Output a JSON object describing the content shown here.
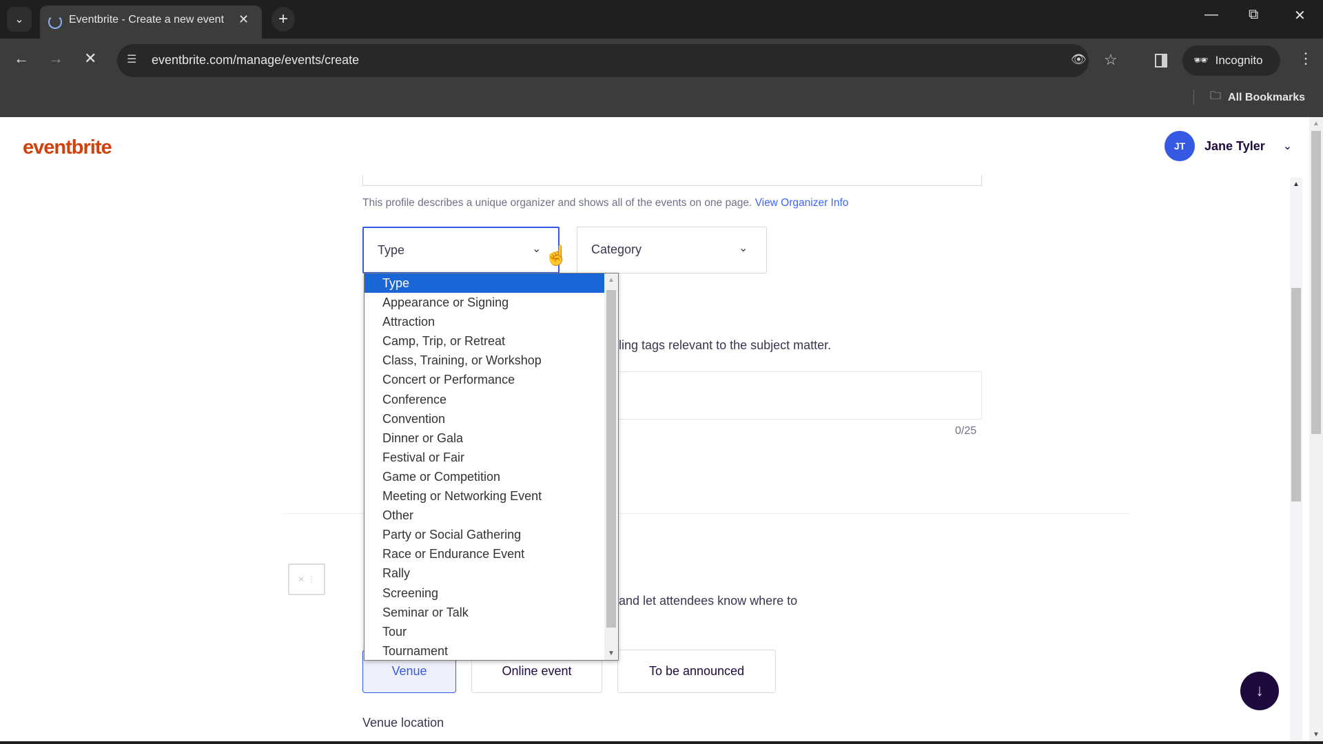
{
  "browser": {
    "tab_title": "Eventbrite - Create a new event",
    "url": "eventbrite.com/manage/events/create",
    "incognito_label": "Incognito",
    "bookmarks_label": "All Bookmarks",
    "icons": {
      "tab_list": "chevron-down-icon",
      "new_tab": "plus-icon",
      "back": "arrow-left-icon",
      "forward": "arrow-right-icon",
      "stop": "close-icon",
      "site_info": "tune-icon",
      "tracking": "eye-off-icon",
      "bookmark": "star-icon",
      "side_panel": "side-panel-icon",
      "menu": "kebab-icon"
    }
  },
  "header": {
    "logo": "eventbrite",
    "user_initials": "JT",
    "user_name": "Jane Tyler"
  },
  "form": {
    "organizer_help": "This profile describes a unique organizer and shows all of the events on one page.",
    "organizer_link": "View Organizer Info",
    "type_select": {
      "value": "Type"
    },
    "category_select": {
      "value": "Category"
    },
    "tags_hint_partial": "ling tags relevant to the subject matter.",
    "tags_count": "0/25",
    "location_hint_partial": "and let attendees know where to",
    "location_options": [
      "Venue",
      "Online event",
      "To be announced"
    ],
    "location_selected": "Venue",
    "venue_location_label": "Venue location"
  },
  "type_dropdown": {
    "highlighted": "Type",
    "options": [
      "Type",
      "Appearance or Signing",
      "Attraction",
      "Camp, Trip, or Retreat",
      "Class, Training, or Workshop",
      "Concert or Performance",
      "Conference",
      "Convention",
      "Dinner or Gala",
      "Festival or Fair",
      "Game or Competition",
      "Meeting or Networking Event",
      "Other",
      "Party or Social Gathering",
      "Race or Endurance Event",
      "Rally",
      "Screening",
      "Seminar or Talk",
      "Tour",
      "Tournament"
    ]
  },
  "colors": {
    "brand": "#d1410c",
    "accent": "#3659e3",
    "highlight": "#1a66d6",
    "fab": "#1e0a3c"
  }
}
